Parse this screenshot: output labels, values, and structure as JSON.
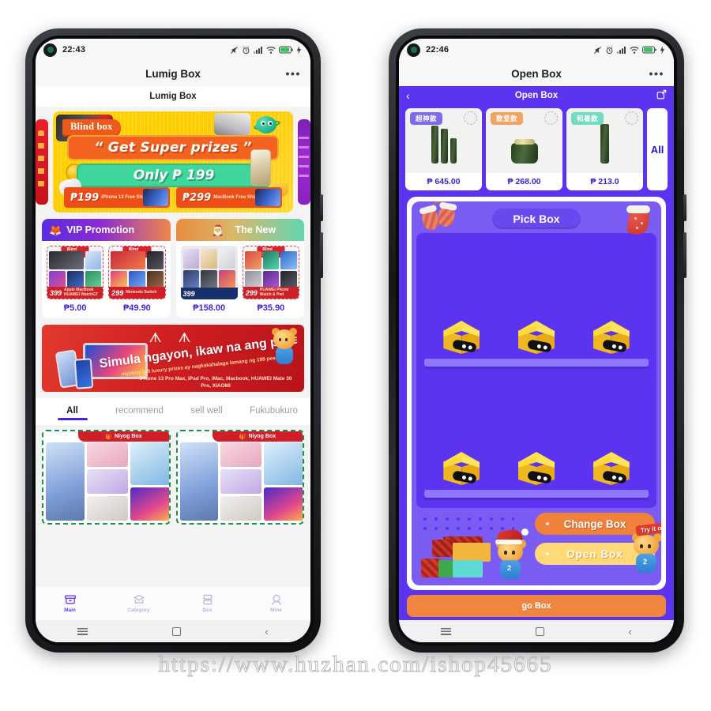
{
  "watermark": "https://www.huzhan.com/ishop45665",
  "left_phone": {
    "status_bar": {
      "time": "22:43",
      "icons": [
        "mute-icon",
        "alarm-icon",
        "signal-icon",
        "wifi-icon",
        "battery-icon",
        "charging-icon"
      ],
      "battery_level": "79"
    },
    "title_bar": {
      "title": "Lumig Box",
      "menu": "•••"
    },
    "subheader": "Lumig Box",
    "carousel": {
      "badge": "Blind box",
      "headline": "“ Get Super prizes ”",
      "price_line": "Only ₱ 199",
      "tickets": [
        {
          "price": "₱199",
          "note": "iPhone 13\nFree Shipping"
        },
        {
          "price": "₱299",
          "note": "MacBook\nFree Shipping"
        }
      ]
    },
    "promos": [
      {
        "title": "VIP Promotion",
        "icon": "fox-icon",
        "items": [
          {
            "price": "₱5.00",
            "badge": "399",
            "caption": "Apple MacBook\nHUAWEI WatchGT"
          },
          {
            "price": "₱49.90",
            "badge": "299",
            "caption": "Nintendo Switch"
          }
        ]
      },
      {
        "title": "The New",
        "icon": "santa-hat-icon",
        "items": [
          {
            "price": "₱158.00",
            "badge": "399",
            "caption": ""
          },
          {
            "price": "₱35.90",
            "badge": "299",
            "caption": "HUAWEI Phone\nWatch & Pad"
          }
        ]
      }
    ],
    "red_banner": {
      "headline": "Simula ngayon, ikaw na ang panalo",
      "subline": "mystery gift luxury prizes ay nagkakahalaga lamang ng 199 pesos",
      "products": "iPhone 13 Pro Max, iPad Pro, iMac,\nMacbook, HUAWEI Mate 30 Pro, XIAOMI"
    },
    "tabs": [
      {
        "label": "All",
        "active": true
      },
      {
        "label": "recommend",
        "active": false
      },
      {
        "label": "sell well",
        "active": false
      },
      {
        "label": "Fukubukuro",
        "active": false
      }
    ],
    "products": [
      {
        "caption": "Niyog Box"
      },
      {
        "caption": "Niyog Box"
      }
    ],
    "bottom_nav": [
      {
        "label": "Main",
        "icon": "box-home-icon",
        "active": true
      },
      {
        "label": "Category",
        "icon": "category-icon",
        "active": false
      },
      {
        "label": "Box",
        "icon": "box-stack-icon",
        "active": false
      },
      {
        "label": "Mine",
        "icon": "person-icon",
        "active": false
      }
    ],
    "android_nav": [
      "menu-icon",
      "home-icon",
      "back-icon"
    ]
  },
  "right_phone": {
    "status_bar": {
      "time": "22:46",
      "icons": [
        "mute-icon",
        "alarm-icon",
        "signal-icon",
        "wifi-icon",
        "battery-icon",
        "charging-icon"
      ],
      "battery_level": "79"
    },
    "title_bar": {
      "title": "Open Box",
      "menu": "•••"
    },
    "app_bar": {
      "title": "Open Box",
      "back": "‹",
      "share": "share-icon"
    },
    "product_strip": [
      {
        "label": "超神款",
        "price": "₱ 645.00",
        "label_color": "#7f6ae8"
      },
      {
        "label": "款爱款",
        "price": "₱ 268.00",
        "label_color": "#f3a261"
      },
      {
        "label": "和暑款",
        "price": "₱ 213.0",
        "label_color": "#73dcc0"
      },
      {
        "label": "All",
        "price": "",
        "label_color": "#ffffff"
      }
    ],
    "game": {
      "pick_button": "Pick Box",
      "boxes_row_1": [
        "mystery-box",
        "mystery-box",
        "mystery-box"
      ],
      "boxes_row_2": [
        "mystery-box",
        "mystery-box",
        "mystery-box"
      ],
      "change_button": "Change Box",
      "open_button": "Open Box",
      "try_tag": "Try it out"
    },
    "go_box_button": "go Box",
    "android_nav": [
      "menu-icon",
      "home-icon",
      "back-icon"
    ]
  }
}
